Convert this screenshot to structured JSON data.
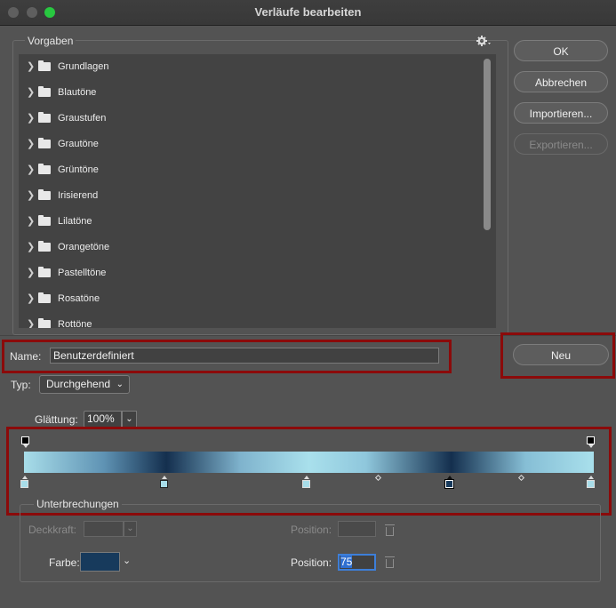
{
  "window": {
    "title": "Verläufe bearbeiten"
  },
  "colors": {
    "highlight_border": "#8b0a0a",
    "traffic_close": "#5f5f5f",
    "traffic_green": "#28c840"
  },
  "presets": {
    "group_label": "Vorgaben",
    "gear_icon": "gear-icon",
    "items": [
      {
        "label": "Grundlagen"
      },
      {
        "label": "Blautöne"
      },
      {
        "label": "Graustufen"
      },
      {
        "label": "Grautöne"
      },
      {
        "label": "Grüntöne"
      },
      {
        "label": "Irisierend"
      },
      {
        "label": "Lilatöne"
      },
      {
        "label": "Orangetöne"
      },
      {
        "label": "Pastelltöne"
      },
      {
        "label": "Rosatöne"
      },
      {
        "label": "Rottöne"
      }
    ]
  },
  "buttons": {
    "ok": "OK",
    "cancel": "Abbrechen",
    "import": "Importieren...",
    "export": "Exportieren...",
    "new": "Neu"
  },
  "name": {
    "label": "Name:",
    "value": "Benutzerdefiniert"
  },
  "type": {
    "label": "Typ:",
    "value": "Durchgehend"
  },
  "smoothing": {
    "label": "Glättung:",
    "value": "100%"
  },
  "stops": {
    "group_label": "Unterbrechungen",
    "opacity_label": "Deckkraft:",
    "opacity_position_label": "Position:",
    "color_label": "Farbe:",
    "color_value": "#173a5c",
    "color_position_label": "Position:",
    "color_position_value": "75"
  }
}
